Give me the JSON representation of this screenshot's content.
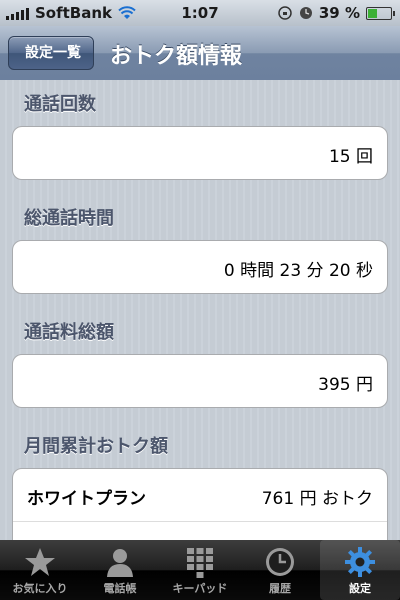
{
  "status": {
    "carrier": "SoftBank",
    "time": "1:07",
    "battery": "39 %",
    "battery_level": 0.39
  },
  "nav": {
    "back_label": "設定一覧",
    "title": "おトク額情報"
  },
  "sections": [
    {
      "header": "通話回数",
      "value": "15 回"
    },
    {
      "header": "総通話時間",
      "value": "0 時間 23 分 20 秒"
    },
    {
      "header": "通話料総額",
      "value": "395 円"
    },
    {
      "header": "月間累計おトク額",
      "row_label": "ホワイトプラン",
      "value": "761 円 おトク"
    }
  ],
  "tabs": [
    {
      "label": "お気に入り",
      "icon": "star-icon"
    },
    {
      "label": "電話帳",
      "icon": "person-icon"
    },
    {
      "label": "キーパッド",
      "icon": "keypad-icon"
    },
    {
      "label": "履歴",
      "icon": "clock-icon"
    },
    {
      "label": "設定",
      "icon": "gear-icon"
    }
  ],
  "colors": {
    "active_tab_icon": "#3d8fe0",
    "nav_bar": "#6c809e",
    "section_text": "#4c566c"
  }
}
